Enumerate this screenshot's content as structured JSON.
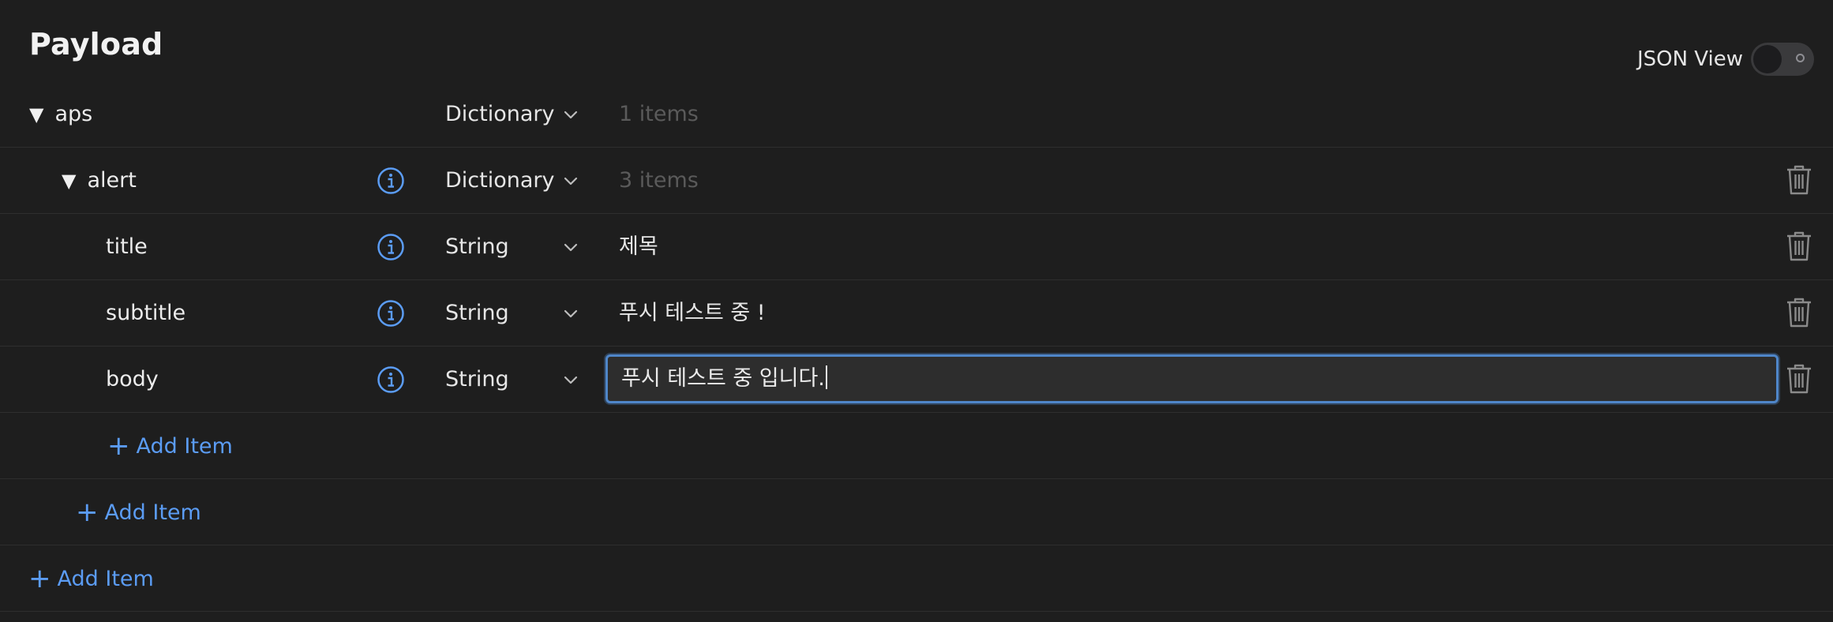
{
  "header": {
    "title": "Payload",
    "json_view_label": "JSON View",
    "json_view_enabled": false
  },
  "rows": [
    {
      "key": "aps",
      "type": "Dictionary",
      "value": "1 items",
      "expanded": true
    },
    {
      "key": "alert",
      "type": "Dictionary",
      "value": "3 items",
      "expanded": true
    },
    {
      "key": "title",
      "type": "String",
      "value": "제목"
    },
    {
      "key": "subtitle",
      "type": "String",
      "value": "푸시 테스트 중 !"
    },
    {
      "key": "body",
      "type": "String",
      "value": "푸시 테스트 중 입니다."
    }
  ],
  "add_items": {
    "alert_level": "Add Item",
    "aps_level": "Add Item",
    "root_level": "Add Item"
  },
  "icons": {
    "expand": "triangle-down-icon",
    "info": "info-circle-icon",
    "chevron": "chevron-down-icon",
    "trash": "trash-icon",
    "add": "plus-icon"
  },
  "colors": {
    "background": "#1e1e1e",
    "accent": "#5b9cf4",
    "focus_border": "#4f86c9",
    "muted_text": "#5a5a5a"
  }
}
